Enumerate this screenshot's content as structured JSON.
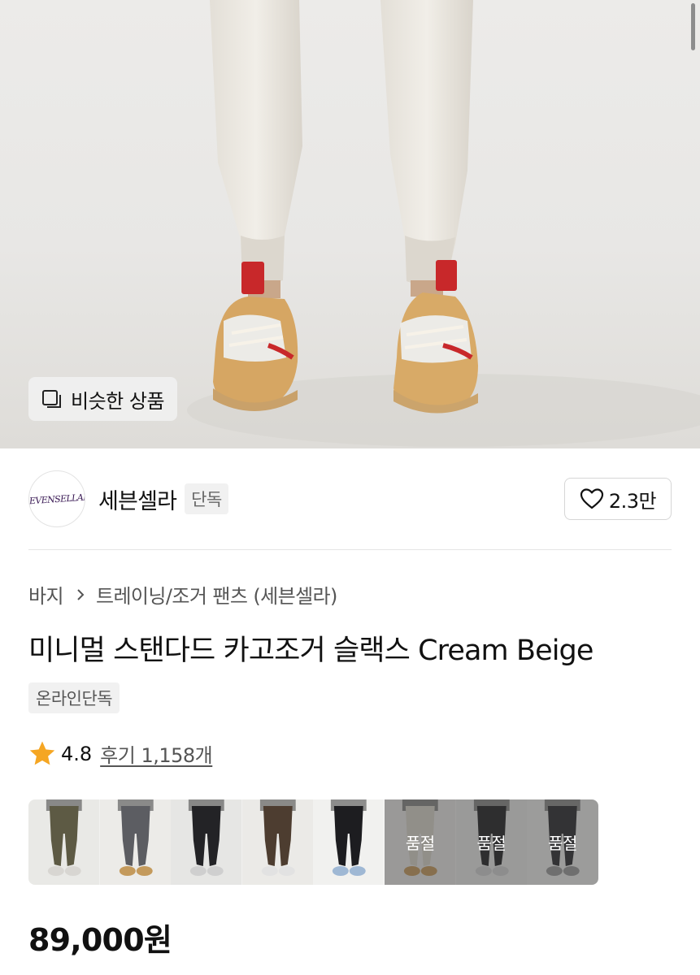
{
  "hero": {
    "similar_products_label": "비슷한 상품"
  },
  "brand": {
    "logo_text": "SEVENSELLAH",
    "name": "세븐셀라",
    "tag": "단독",
    "like_count": "2.3만"
  },
  "breadcrumb": {
    "category": "바지",
    "subcategory": "트레이닝/조거 팬츠 (세븐셀라)"
  },
  "product": {
    "title": "미니멀 스탠다드 카고조거 슬랙스 Cream Beige",
    "exclusive_badge": "온라인단독",
    "rating": "4.8",
    "reviews_label": "후기 1,158개",
    "price": "89,000원"
  },
  "color_thumbnails": [
    {
      "color": "khaki",
      "pants_hex": "#5d5a44",
      "bg_hex": "#e9e9e6",
      "shoe_hex": "#d8d6d2",
      "soldout": false
    },
    {
      "color": "charcoal",
      "pants_hex": "#5c5d62",
      "bg_hex": "#ecebe8",
      "shoe_hex": "#c49a5c",
      "soldout": false
    },
    {
      "color": "black",
      "pants_hex": "#232326",
      "bg_hex": "#e6e6e4",
      "shoe_hex": "#cfcfcf",
      "soldout": false
    },
    {
      "color": "brown",
      "pants_hex": "#4d3d30",
      "bg_hex": "#ebeae7",
      "shoe_hex": "#e2e2e2",
      "soldout": false
    },
    {
      "color": "black2",
      "pants_hex": "#1d1d20",
      "bg_hex": "#f1f1ef",
      "shoe_hex": "#9fb8d4",
      "soldout": false
    },
    {
      "color": "cream",
      "pants_hex": "#d8d3c9",
      "bg_hex": "#e7e6e3",
      "shoe_hex": "#c59a5d",
      "soldout": true,
      "soldout_label": "품절"
    },
    {
      "color": "black3",
      "pants_hex": "#232325",
      "bg_hex": "#e8e8e6",
      "shoe_hex": "#d0d0d0",
      "soldout": true,
      "soldout_label": "품절"
    },
    {
      "color": "darkgray",
      "pants_hex": "#2d2d30",
      "bg_hex": "#ebebe9",
      "shoe_hex": "#9a9a9a",
      "soldout": true,
      "soldout_label": "품절"
    }
  ],
  "colors": {
    "star": "#f5a623",
    "brand_logo_ink": "#3a1a55"
  }
}
